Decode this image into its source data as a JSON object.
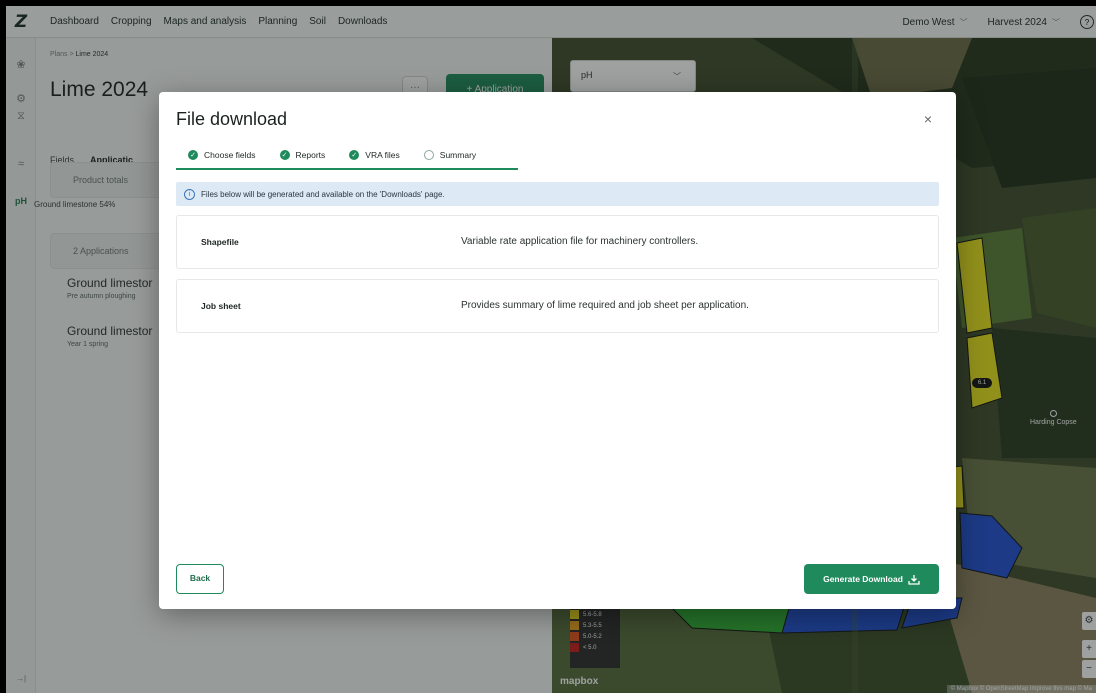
{
  "app": {
    "logo": "Z",
    "nav": [
      "Dashboard",
      "Cropping",
      "Maps and analysis",
      "Planning",
      "Soil",
      "Downloads"
    ],
    "farm_selector": "Demo West",
    "harvest_selector": "Harvest 2024",
    "help_icon": "?"
  },
  "rail": {
    "icons": [
      "crop-icon",
      "analysis-icon",
      "planning-icon",
      "soil-icon"
    ],
    "active_label": "pH",
    "collapse_icon": "→|"
  },
  "plan": {
    "breadcrumb_root": "Plans",
    "breadcrumb_sep": ">",
    "breadcrumb_current": "Lime 2024",
    "title": "Lime 2024",
    "more_label": "···",
    "add_label": "+ Application",
    "tabs": [
      "Fields",
      "Applicatic"
    ],
    "product_totals_label": "Product totals",
    "product_row": "Ground limestone 54%",
    "applications_count_label": "2 Applications",
    "applications": [
      {
        "name": "Ground limestor",
        "sub": "Pre autumn ploughing"
      },
      {
        "name": "Ground limestor",
        "sub": "Year 1 spring"
      }
    ]
  },
  "map": {
    "layer_select": "pH",
    "legend": [
      {
        "label": "5.6-5.8",
        "color": "#f5e019"
      },
      {
        "label": "5.3-5.5",
        "color": "#f2a21c"
      },
      {
        "label": "5.0-5.2",
        "color": "#e3521b"
      },
      {
        "label": "< 5.0",
        "color": "#c41a1a"
      }
    ],
    "place_name": "Harding Copse",
    "badge_value": "6.1",
    "mapbox_label": "mapbox",
    "attribution": "© Mapbox © OpenStreetMap Improve this map © Ma",
    "zoom_in": "+",
    "zoom_out": "−",
    "settings_icon": "⚙"
  },
  "modal": {
    "title": "File download",
    "close": "×",
    "steps": [
      {
        "label": "Choose fields",
        "done": true
      },
      {
        "label": "Reports",
        "done": true
      },
      {
        "label": "VRA files",
        "done": true
      },
      {
        "label": "Summary",
        "done": false
      }
    ],
    "info": "Files below will be generated and available on the 'Downloads' page.",
    "files": [
      {
        "name": "Shapefile",
        "description": "Variable rate application file for machinery controllers."
      },
      {
        "name": "Job sheet",
        "description": "Provides summary of lime required and job sheet per application."
      }
    ],
    "back_label": "Back",
    "generate_label": "Generate Download"
  },
  "colors": {
    "accent": "#1f8a5c",
    "info_bg": "#dde9f5",
    "ph_blue": "#1f4fd1",
    "ph_green": "#2fae33",
    "ph_yellow": "#e9e21a"
  }
}
